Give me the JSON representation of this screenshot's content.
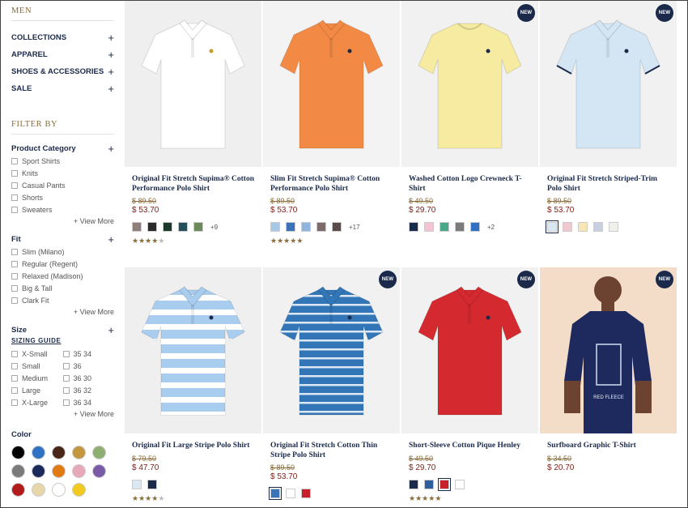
{
  "sidebar": {
    "title": "MEN",
    "nav": [
      {
        "label": "COLLECTIONS",
        "icon": "+"
      },
      {
        "label": "APPAREL",
        "icon": "+"
      },
      {
        "label": "SHOES & ACCESSORIES",
        "icon": "+"
      },
      {
        "label": "SALE",
        "icon": "+"
      }
    ],
    "filter_title": "FILTER BY",
    "category": {
      "label": "Product Category",
      "icon": "+",
      "options": [
        "Sport Shirts",
        "Knits",
        "Casual Pants",
        "Shorts",
        "Sweaters"
      ],
      "view_more": "+ View More"
    },
    "fit": {
      "label": "Fit",
      "icon": "+",
      "options": [
        "Slim (Milano)",
        "Regular (Regent)",
        "Relaxed (Madison)",
        "Big & Tall",
        "Clark Fit"
      ],
      "view_more": "+ View More"
    },
    "size": {
      "label": "Size",
      "icon": "+",
      "sizing_guide": "SIZING GUIDE",
      "col1": [
        "X-Small",
        "Small",
        "Medium",
        "Large",
        "X-Large"
      ],
      "col2": [
        "35 34",
        "36",
        "36 30",
        "36 32",
        "36 34"
      ],
      "view_more": "+ View More"
    },
    "color": {
      "label": "Color",
      "swatches": [
        "#000000",
        "#2f72c4",
        "#4a2619",
        "#c4963f",
        "#8fae72",
        "#7a7a7a",
        "#1b2a5a",
        "#e07a12",
        "#e7a9b9",
        "#7b5aa6",
        "#b21b1b",
        "#e6d6a8",
        "#ffffff",
        "#f2c91f"
      ]
    }
  },
  "products": [
    {
      "name": "Original Fit Stretch Supima® Cotton Performance Polo Shirt",
      "old_price": "$ 89.50",
      "price": "$ 53.70",
      "is_new": false,
      "badge": "",
      "swatches": [
        "#8f7f7a",
        "#2b2b2b",
        "#1b3a2a",
        "#234e5a",
        "#6f8a5a"
      ],
      "more": "+9",
      "rating": 4,
      "shirt_color": "#ffffff",
      "bg": "#efefef"
    },
    {
      "name": "Slim Fit Stretch Supima® Cotton Performance Polo Shirt",
      "old_price": "$ 89.50",
      "price": "$ 53.70",
      "is_new": false,
      "badge": "",
      "swatches": [
        "#a9c8e8",
        "#3a73b8",
        "#8fb4e0",
        "#7d6b6b",
        "#5a4a4a"
      ],
      "more": "+17",
      "rating": 4.5,
      "shirt_color": "#f28a45",
      "bg": "#f3f3f3"
    },
    {
      "name": "Washed Cotton Logo Crewneck T-Shirt",
      "old_price": "$ 49.50",
      "price": "$ 29.70",
      "is_new": true,
      "badge": "NEW",
      "swatches": [
        "#1b2a4a",
        "#f2c4d4",
        "#4aa88a",
        "#7a7a7a",
        "#2f72c4"
      ],
      "more": "+2",
      "rating": 0,
      "shirt_color": "#f6eba0",
      "bg": "#f1f1f1"
    },
    {
      "name": "Original Fit Stretch Striped-Trim Polo Shirt",
      "old_price": "$ 89.50",
      "price": "$ 53.70",
      "is_new": true,
      "badge": "NEW",
      "swatches": [
        "#dbe8f4",
        "#f0c8d0",
        "#f6e6b4",
        "#c8d0e0",
        "#f2f0ea"
      ],
      "more": "",
      "rating": 0,
      "shirt_color": "#d4e6f4",
      "bg": "#f1f1f1"
    },
    {
      "name": "Original Fit Large Stripe Polo Shirt",
      "old_price": "$ 79.50",
      "price": "$ 47.70",
      "is_new": false,
      "badge": "",
      "swatches": [
        "#dbe8f4",
        "#1b2a4a"
      ],
      "more": "",
      "rating": 4,
      "shirt_color": "#a9cdee",
      "bg": "#efefef"
    },
    {
      "name": "Original Fit Stretch Cotton Thin Stripe Polo Shirt",
      "old_price": "$ 89.50",
      "price": "$ 53.70",
      "is_new": true,
      "badge": "NEW",
      "swatches": [
        "#3a73b8",
        "#ffffff",
        "#c8202a"
      ],
      "more": "",
      "rating": 0,
      "shirt_color": "#3276b8",
      "bg": "#f1f1f1"
    },
    {
      "name": "Short-Sleeve Cotton Pique Henley",
      "old_price": "$ 49.50",
      "price": "$ 29.70",
      "is_new": true,
      "badge": "NEW",
      "swatches": [
        "#1b2a4a",
        "#2f5e9e",
        "#c8202a",
        "#ffffff"
      ],
      "more": "",
      "rating": 4.5,
      "shirt_color": "#d42a2f",
      "bg": "#f1f1f1"
    },
    {
      "name": "Surfboard Graphic T-Shirt",
      "old_price": "$ 34.50",
      "price": "$ 20.70",
      "is_new": true,
      "badge": "NEW",
      "swatches": [],
      "more": "",
      "rating": 0,
      "shirt_color": "#1e2a5e",
      "bg": "#f3dcc8"
    }
  ]
}
